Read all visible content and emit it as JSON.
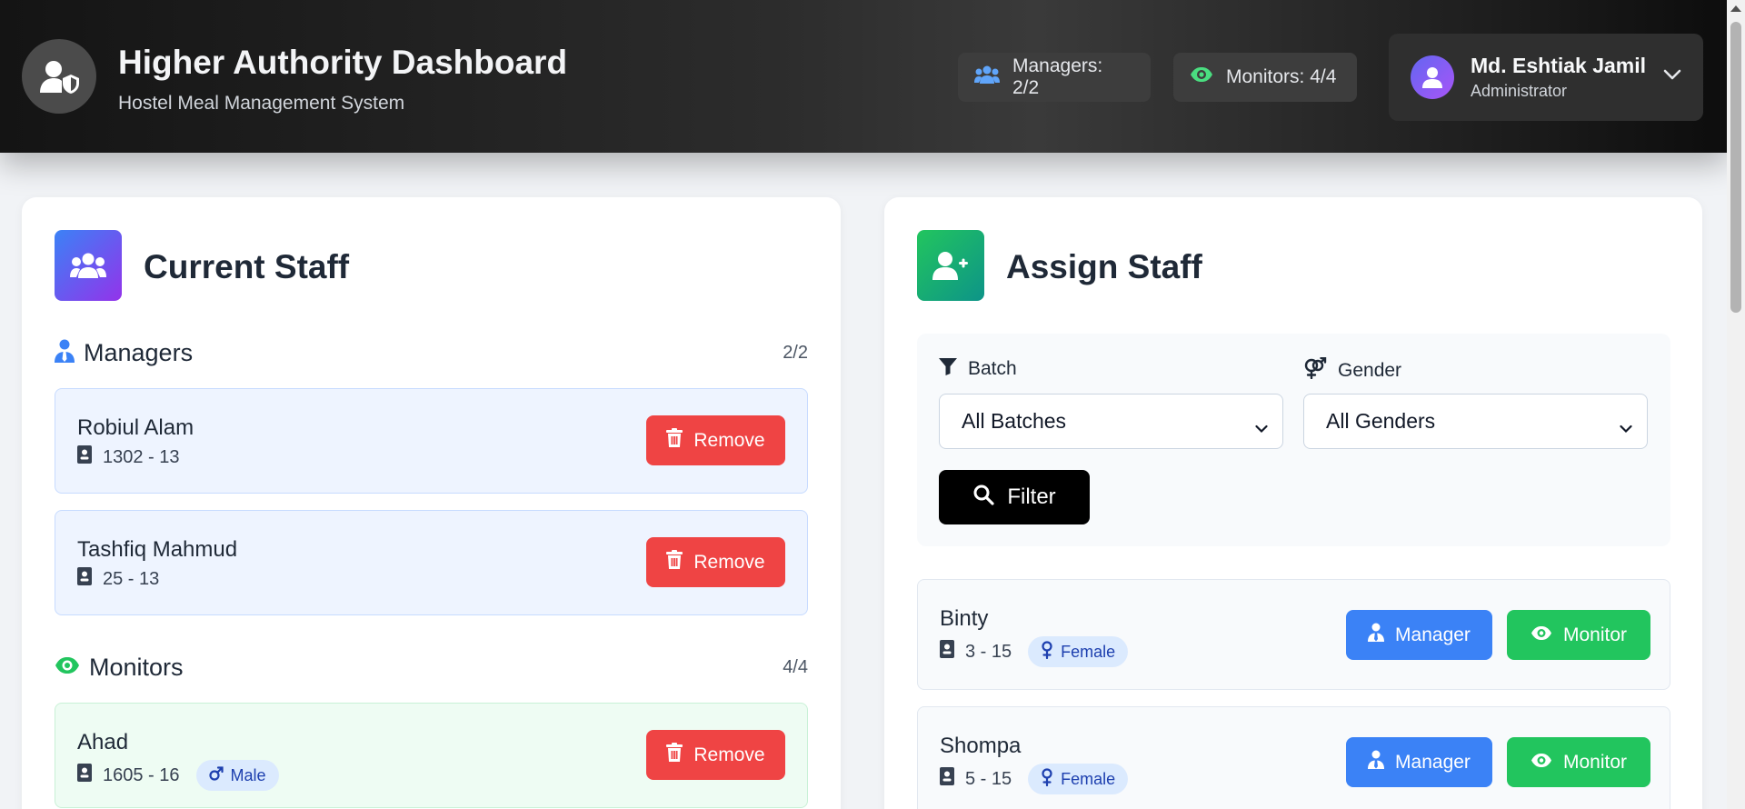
{
  "header": {
    "title": "Higher Authority Dashboard",
    "subtitle": "Hostel Meal Management System",
    "stats": {
      "managers_label": "Managers: 2/2",
      "monitors_label": "Monitors: 4/4"
    },
    "user": {
      "name": "Md. Eshtiak Jamil",
      "role": "Administrator"
    }
  },
  "current_staff": {
    "title": "Current Staff",
    "managers": {
      "label": "Managers",
      "count": "2/2",
      "items": [
        {
          "name": "Robiul Alam",
          "id": "1302 - 13",
          "action": "Remove"
        },
        {
          "name": "Tashfiq Mahmud",
          "id": "25 - 13",
          "action": "Remove"
        }
      ]
    },
    "monitors": {
      "label": "Monitors",
      "count": "4/4",
      "items": [
        {
          "name": "Ahad",
          "id": "1605 - 16",
          "gender": "Male",
          "action": "Remove"
        }
      ]
    }
  },
  "assign_staff": {
    "title": "Assign Staff",
    "filters": {
      "batch_label": "Batch",
      "batch_value": "All Batches",
      "gender_label": "Gender",
      "gender_value": "All Genders",
      "filter_button": "Filter"
    },
    "candidates": [
      {
        "name": "Binty",
        "id": "3 - 15",
        "gender": "Female",
        "manager_label": "Manager",
        "monitor_label": "Monitor"
      },
      {
        "name": "Shompa",
        "id": "5 - 15",
        "gender": "Female",
        "manager_label": "Manager",
        "monitor_label": "Monitor"
      }
    ]
  },
  "colors": {
    "remove": "#ef4444",
    "manager": "#3b82f6",
    "monitor": "#22c55e",
    "filter": "#000000"
  },
  "icons": [
    "user-shield-icon",
    "users-icon",
    "eye-icon",
    "user-icon",
    "chevron-down-icon",
    "user-plus-icon",
    "user-tie-icon",
    "id-card-icon",
    "trash-icon",
    "male-icon",
    "female-icon",
    "filter-icon",
    "venus-mars-icon",
    "search-icon"
  ]
}
